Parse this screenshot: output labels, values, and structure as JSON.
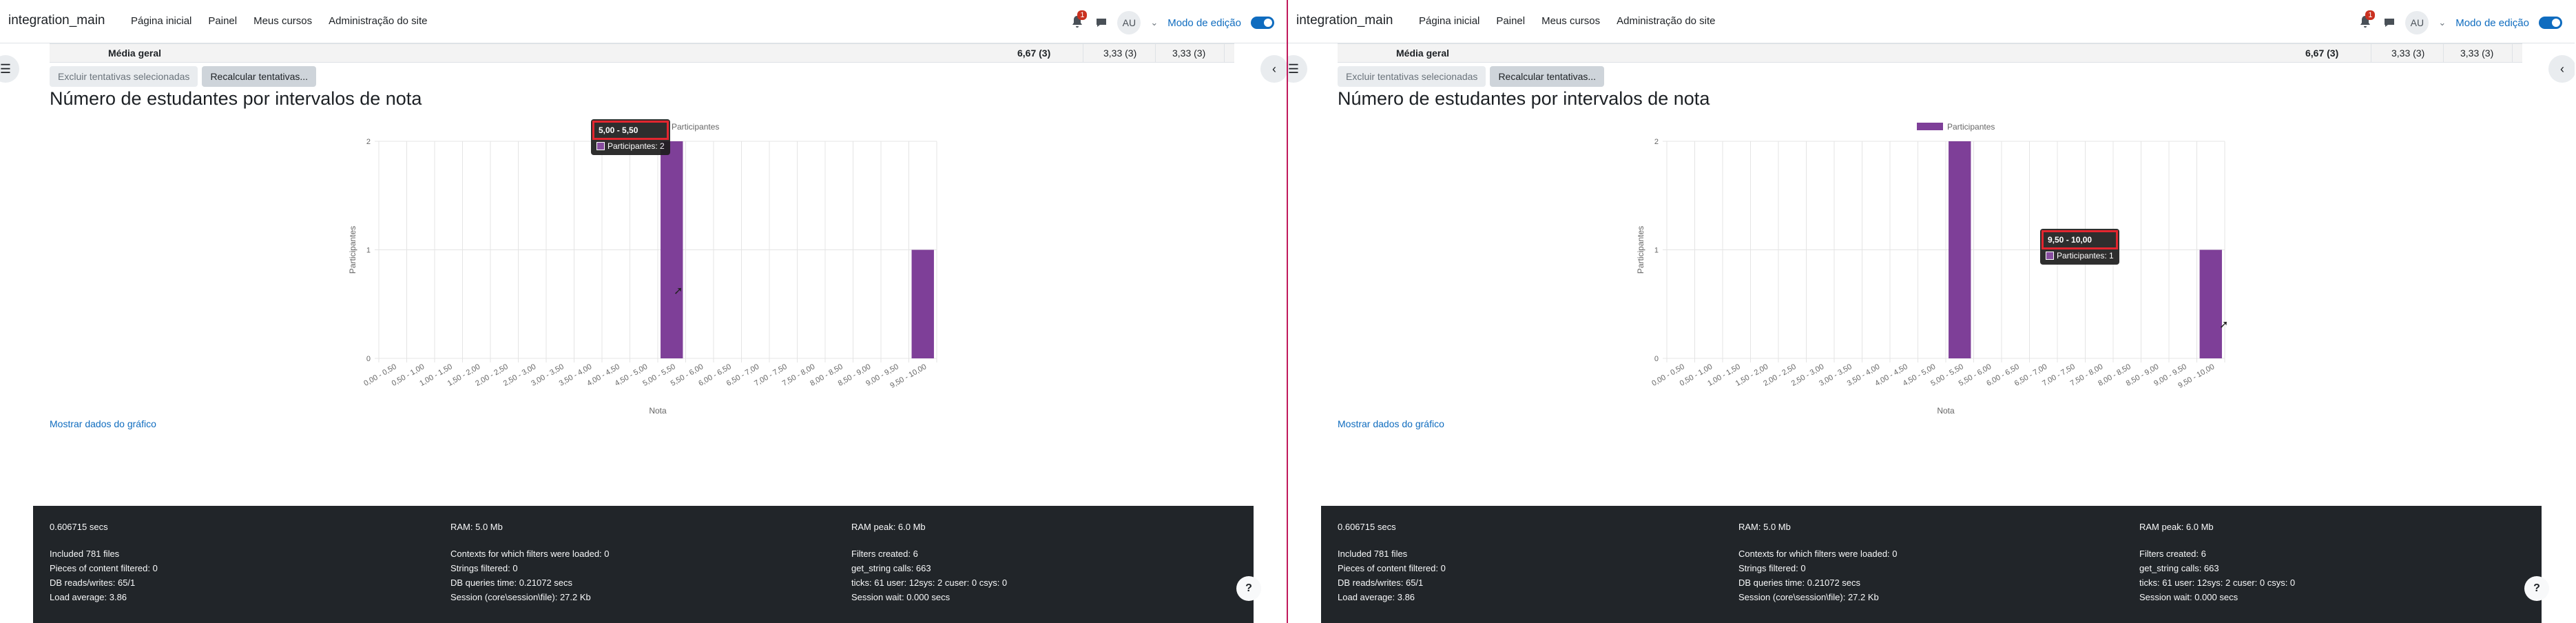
{
  "nav": {
    "brand": "integration_main",
    "links": [
      "Página inicial",
      "Painel",
      "Meus cursos",
      "Administração do site"
    ],
    "notif_count": "1",
    "avatar": "AU",
    "edit_mode": "Modo de edição"
  },
  "table": {
    "label": "Média geral",
    "values": [
      "6,67 (3)",
      "3,33 (3)",
      "3,33 (3)"
    ]
  },
  "buttons": {
    "delete": "Excluir tentativas selecionadas",
    "regrade": "Recalcular tentativas..."
  },
  "heading": "Número de estudantes por intervalos de nota",
  "chart_data": {
    "type": "bar",
    "legend": "Participantes",
    "xlabel": "Nota",
    "ylabel": "Participantes",
    "ylim": [
      0,
      2
    ],
    "yticks": [
      "0",
      "1",
      "2"
    ],
    "grid": true,
    "legend_position": "top",
    "color": "#7e3f98",
    "categories": [
      "0,00 - 0,50",
      "0,50 - 1,00",
      "1,00 - 1,50",
      "1,50 - 2,00",
      "2,00 - 2,50",
      "2,50 - 3,00",
      "3,00 - 3,50",
      "3,50 - 4,00",
      "4,00 - 4,50",
      "4,50 - 5,00",
      "5,00 - 5,50",
      "5,50 - 6,00",
      "6,00 - 6,50",
      "6,50 - 7,00",
      "7,00 - 7,50",
      "7,50 - 8,00",
      "8,00 - 8,50",
      "8,50 - 9,00",
      "9,00 - 9,50",
      "9,50 - 10,00"
    ],
    "values": [
      0,
      0,
      0,
      0,
      0,
      0,
      0,
      0,
      0,
      0,
      2,
      0,
      0,
      0,
      0,
      0,
      0,
      0,
      0,
      1
    ]
  },
  "tooltips": {
    "left": {
      "title": "5,00 - 5,50",
      "label": "Participantes: 2"
    },
    "right": {
      "title": "9,50 - 10,00",
      "label": "Participantes: 1"
    }
  },
  "show_data": "Mostrar dados do gráfico",
  "footer": {
    "col1": [
      "0.606715 secs",
      "",
      "Included 781 files",
      "Pieces of content filtered: 0",
      "DB reads/writes: 65/1",
      "Load average: 3.86"
    ],
    "col2": [
      "RAM: 5.0 Mb",
      "",
      "Contexts for which filters were loaded: 0",
      "Strings filtered: 0",
      "DB queries time: 0.21072 secs",
      "Session (core\\session\\file): 27.2 Kb"
    ],
    "col3": [
      "RAM peak: 6.0 Mb",
      "",
      "Filters created: 6",
      "get_string calls: 663",
      "ticks: 61 user: 12sys: 2 cuser: 0 csys: 0",
      "Session wait: 0.000 secs"
    ]
  },
  "help": "?"
}
